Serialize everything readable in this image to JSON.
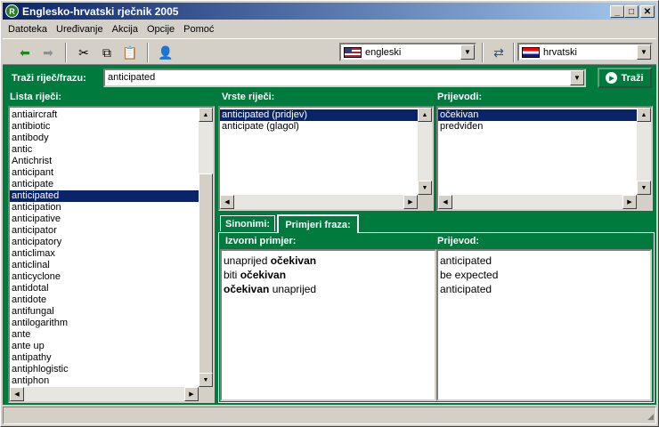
{
  "window": {
    "title": "Englesko-hrvatski rječnik 2005",
    "app_icon": "R"
  },
  "titlebar_buttons": {
    "minimize": "_",
    "maximize": "□",
    "close": "✕"
  },
  "menu": [
    "Datoteka",
    "Uređivanje",
    "Akcija",
    "Opcije",
    "Pomoć"
  ],
  "toolbar": {
    "back_icon": "⬅",
    "forward_icon": "➡",
    "cut_icon": "✂",
    "copy_icon": "⧉",
    "paste_icon": "📋",
    "user_icon": "👤",
    "swap_icon": "⇄",
    "source_language": "engleski",
    "target_language": "hrvatski"
  },
  "search": {
    "label": "Traži riječ/frazu:",
    "value": "anticipated",
    "button": "Traži",
    "button_icon": "▶"
  },
  "wordlist": {
    "label": "Lista riječi:",
    "selected": 7,
    "items": [
      "antiaircraft",
      "antibiotic",
      "antibody",
      "antic",
      "Antichrist",
      "anticipant",
      "anticipate",
      "anticipated",
      "anticipation",
      "anticipative",
      "anticipator",
      "anticipatory",
      "anticlimax",
      "anticlinal",
      "anticyclone",
      "antidotal",
      "antidote",
      "antifungal",
      "antilogarithm",
      "ante",
      "ante up",
      "antipathy",
      "antiphlogistic",
      "antiphon"
    ]
  },
  "word_types": {
    "label": "Vrste riječi:",
    "selected": 0,
    "items": [
      "anticipated (pridjev)",
      "anticipate (glagol)"
    ]
  },
  "translations": {
    "label": "Prijevodi:",
    "selected": 0,
    "items": [
      "očekivan",
      "predviđen"
    ]
  },
  "tabs": [
    "Sinonimi:",
    "Primjeri fraza:"
  ],
  "examples": {
    "source_label": "Izvorni primjer:",
    "target_label": "Prijevod:",
    "source_lines": [
      {
        "plain": "unaprijed ",
        "bold": "očekivan",
        "after": ""
      },
      {
        "plain": "biti ",
        "bold": "očekivan",
        "after": ""
      },
      {
        "plain": "",
        "bold": "očekivan",
        "after": " unaprijed"
      }
    ],
    "target_lines": [
      "anticipated",
      "be expected",
      "anticipated"
    ]
  },
  "colors": {
    "panel": "#007a3d",
    "selection": "#0a246a",
    "titlebar": "#0a246a"
  }
}
